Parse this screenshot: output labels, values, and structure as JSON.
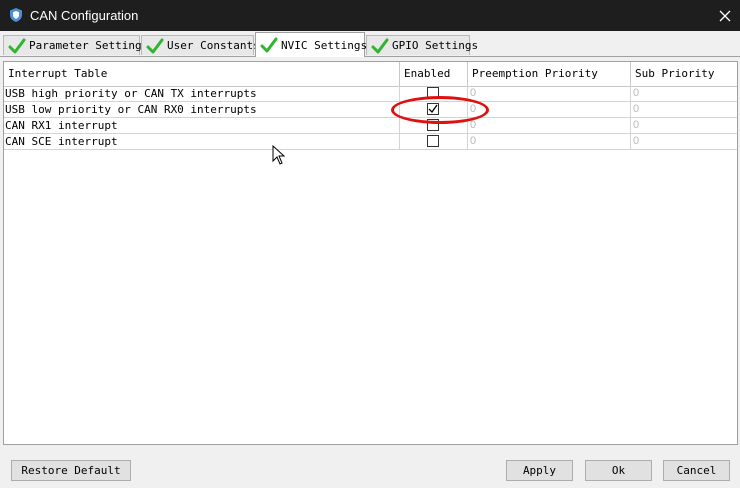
{
  "window": {
    "title": "CAN Configuration",
    "app_icon": "shield-icon",
    "close_icon": "close-icon"
  },
  "tabs": [
    {
      "label": "Parameter Settings",
      "icon": "check-icon",
      "active": false
    },
    {
      "label": "User Constants",
      "icon": "check-icon",
      "active": false
    },
    {
      "label": "NVIC Settings",
      "icon": "check-icon",
      "active": true
    },
    {
      "label": "GPIO Settings",
      "icon": "check-icon",
      "active": false
    }
  ],
  "table": {
    "columns": [
      "Interrupt Table",
      "Enabled",
      "Preemption Priority",
      "Sub Priority"
    ],
    "rows": [
      {
        "name": "USB high priority or CAN TX interrupts",
        "enabled": false,
        "preemption": "0",
        "sub": "0"
      },
      {
        "name": "USB low priority or CAN RX0 interrupts",
        "enabled": true,
        "preemption": "0",
        "sub": "0"
      },
      {
        "name": "CAN RX1 interrupt",
        "enabled": false,
        "preemption": "0",
        "sub": "0"
      },
      {
        "name": "CAN SCE interrupt",
        "enabled": false,
        "preemption": "0",
        "sub": "0"
      }
    ]
  },
  "buttons": {
    "restore": "Restore Default",
    "apply": "Apply",
    "ok": "Ok",
    "cancel": "Cancel"
  },
  "colors": {
    "check_green": "#2fb52f",
    "highlight": "#e01010",
    "titlebar": "#1e1e1e"
  }
}
